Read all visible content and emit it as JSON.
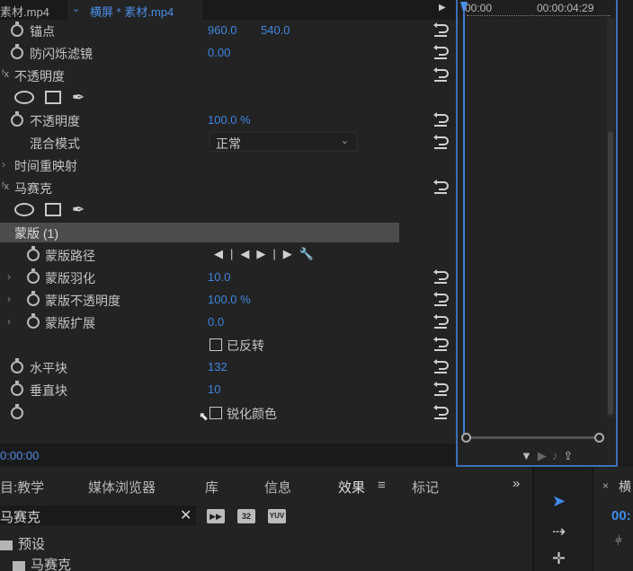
{
  "tabs": {
    "source": "素材.mp4",
    "sequence": "横屏 * 素材.mp4"
  },
  "effect_controls": {
    "anchor": {
      "label": "锚点",
      "x": "960.0",
      "y": "540.0"
    },
    "antiflicker": {
      "label": "防闪烁滤镜",
      "value": "0.00"
    },
    "opacity_section": "不透明度",
    "opacity": {
      "label": "不透明度",
      "value": "100.0 %"
    },
    "blend_mode": {
      "label": "混合模式",
      "value": "正常"
    },
    "time_remap": "时间重映射",
    "mosaic_section": "马赛克",
    "mask_header": "蒙版 (1)",
    "mask_path": "蒙版路径",
    "mask_feather": {
      "label": "蒙版羽化",
      "value": "10.0"
    },
    "mask_opacity": {
      "label": "蒙版不透明度",
      "value": "100.0 %"
    },
    "mask_expansion": {
      "label": "蒙版扩展",
      "value": "0.0"
    },
    "inverted": "已反转",
    "horizontal_blocks": {
      "label": "水平块",
      "value": "132"
    },
    "vertical_blocks": {
      "label": "垂直块",
      "value": "10"
    },
    "sharpen_colors": "锐化颜色",
    "timecode": "0:00:00"
  },
  "timeline": {
    "start": "00:00",
    "end": "00:00:04:29"
  },
  "bottom_panel": {
    "tabs": [
      "目:教学",
      "媒体浏览器",
      "库",
      "信息",
      "效果",
      "标记"
    ],
    "active_tab": "效果",
    "search_value": "马赛克",
    "badges": [
      "32",
      "YUV"
    ],
    "tree": [
      "预设",
      "马赛克"
    ]
  },
  "right_panel": {
    "label": "横",
    "timecode": "00:"
  },
  "colors": {
    "accent": "#3f86e0",
    "panel": "#232323",
    "mask_header": "#4c4c4c"
  }
}
